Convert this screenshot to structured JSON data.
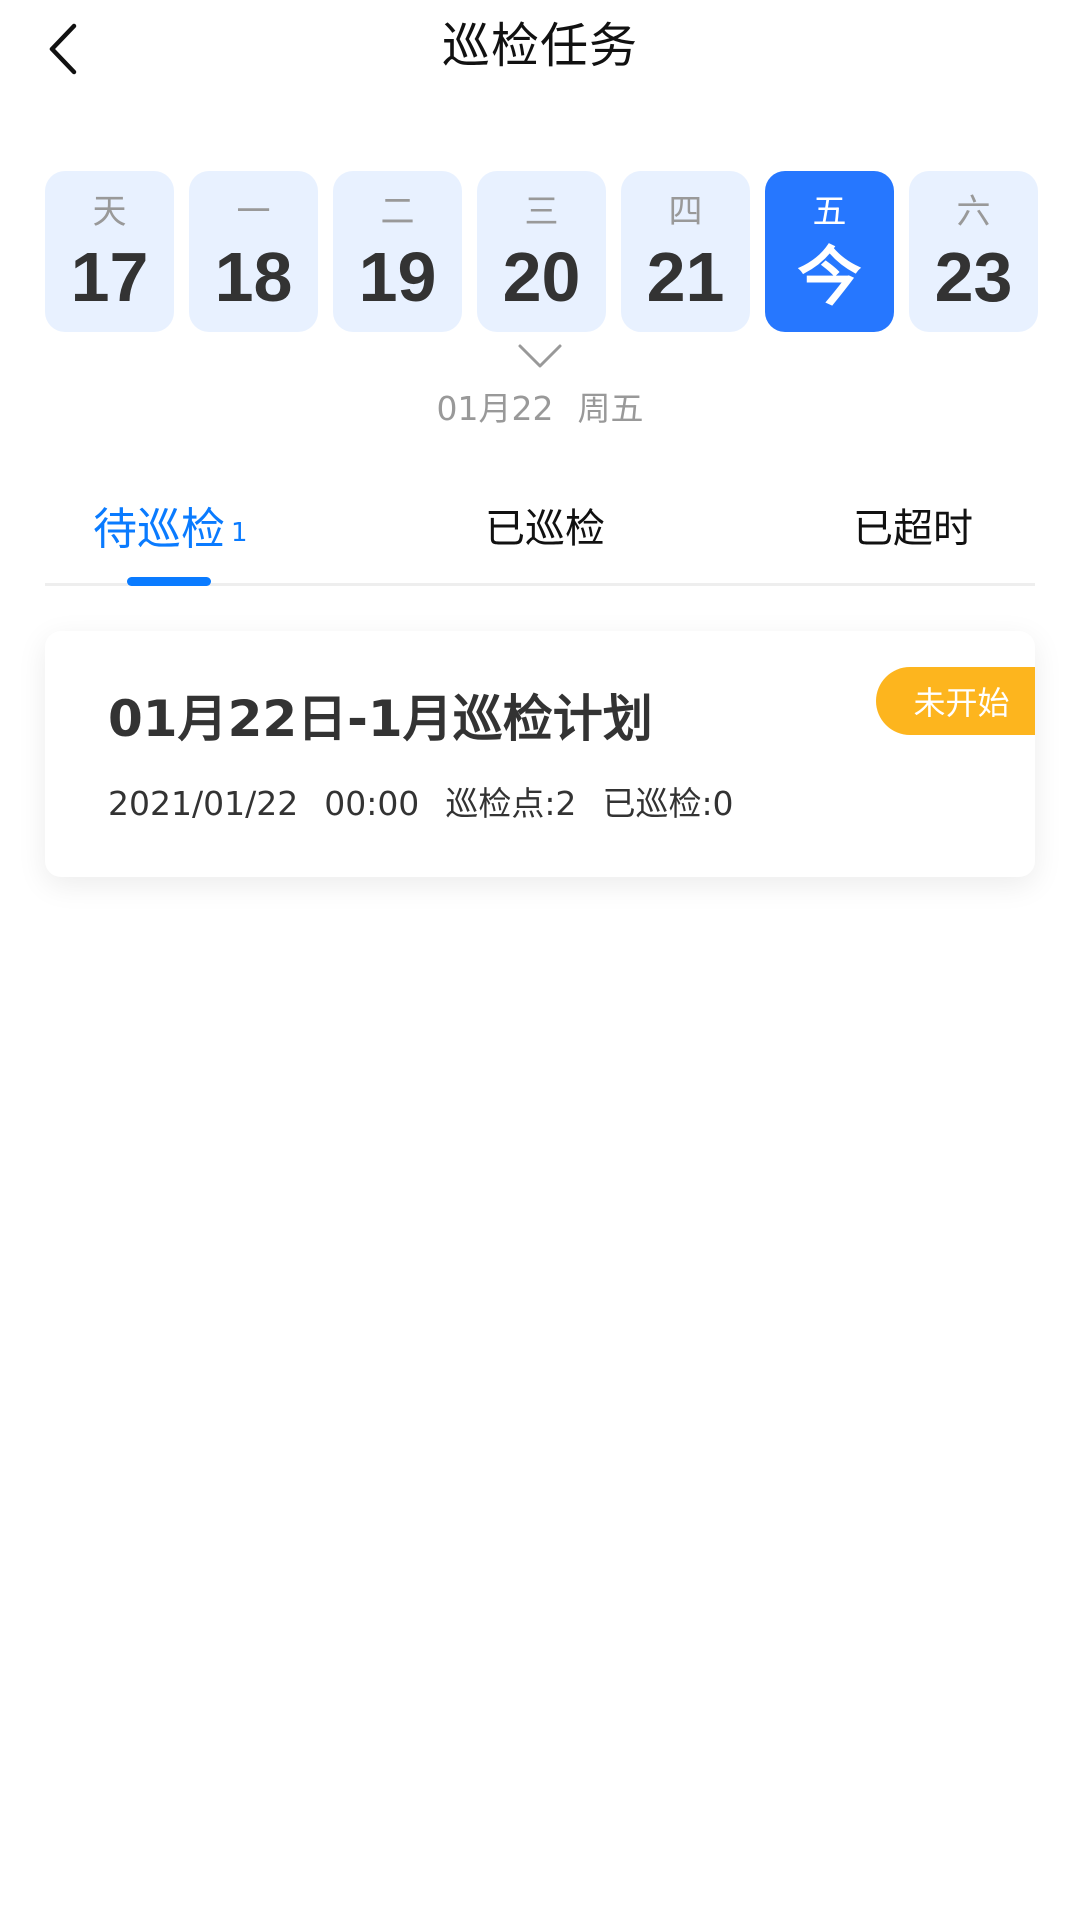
{
  "header": {
    "title": "巡检任务",
    "back_icon": "chevron-left-icon"
  },
  "calendar": {
    "days": [
      {
        "weekday": "天",
        "label": "17",
        "selected": false
      },
      {
        "weekday": "一",
        "label": "18",
        "selected": false
      },
      {
        "weekday": "二",
        "label": "19",
        "selected": false
      },
      {
        "weekday": "三",
        "label": "20",
        "selected": false
      },
      {
        "weekday": "四",
        "label": "21",
        "selected": false
      },
      {
        "weekday": "五",
        "label": "今",
        "selected": true
      },
      {
        "weekday": "六",
        "label": "23",
        "selected": false
      }
    ],
    "expand_icon": "chevron-down-icon",
    "selected_date": "01月22",
    "selected_weekday": "周五"
  },
  "tabs": [
    {
      "label": "待巡检",
      "count": "1",
      "active": true
    },
    {
      "label": "已巡检",
      "count": "",
      "active": false
    },
    {
      "label": "已超时",
      "count": "",
      "active": false
    }
  ],
  "tasks": [
    {
      "title": "01月22日-1月巡检计划",
      "date": "2021/01/22",
      "time": "00:00",
      "points": "巡检点:2",
      "inspected": "已巡检:0",
      "status": "未开始"
    }
  ],
  "colors": {
    "accent": "#0A7BFF",
    "selected_day": "#2677FF",
    "day_bg": "#E8F1FF",
    "status_badge": "#FDB51E"
  }
}
